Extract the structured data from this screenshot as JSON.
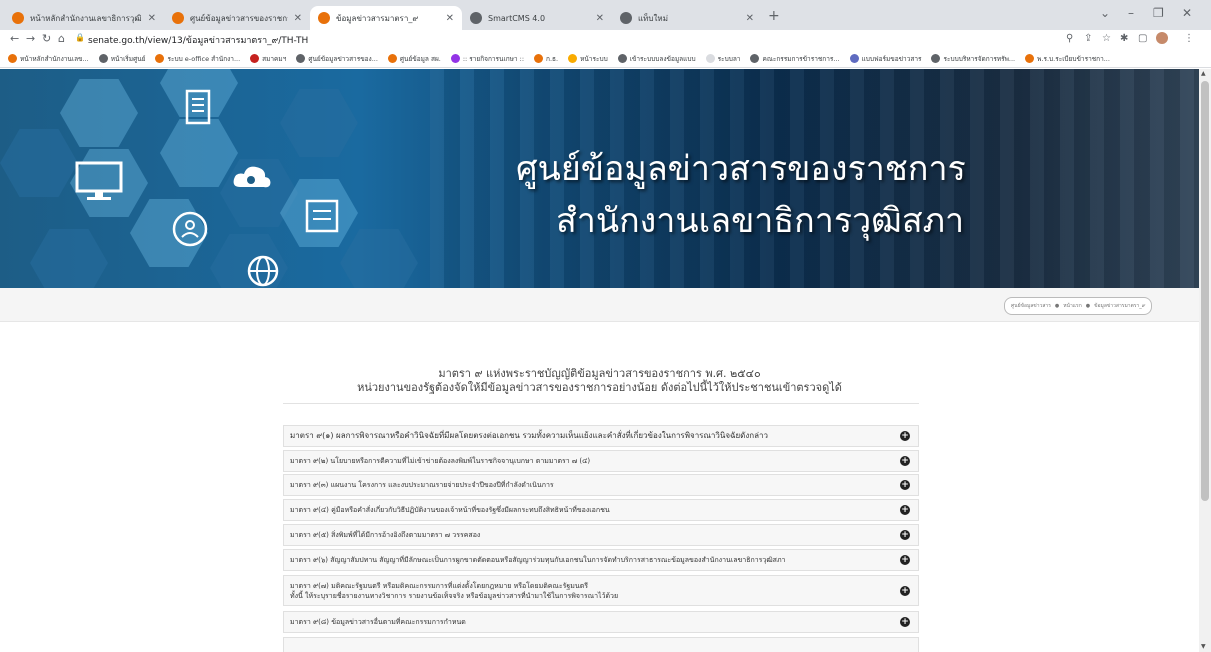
{
  "browser": {
    "tabs": [
      {
        "title": "หน้าหลักสำนักงานเลขาธิการวุฒิสภา",
        "color": "#e8710a"
      },
      {
        "title": "ศูนย์ข้อมูลข่าวสารของราชการ สำนัก",
        "color": "#e8710a"
      },
      {
        "title": "ข้อมูลข่าวสารมาตรา_๙",
        "color": "#e8710a"
      },
      {
        "title": "SmartCMS 4.0",
        "color": "#5f6368"
      },
      {
        "title": "แท็บใหม่",
        "color": "#5f6368"
      }
    ],
    "new_tab": "+",
    "url": "senate.go.th/view/13/ข้อมูลข่าวสารมาตรา_๙/TH-TH",
    "bookmarks": [
      {
        "label": "หน้าหลักสำนักงานเลข...",
        "color": "#e8710a"
      },
      {
        "label": "หน้าเริ่มศูนย์",
        "color": "#5f6368"
      },
      {
        "label": "ระบบ e-office สำนักงา...",
        "color": "#e8710a"
      },
      {
        "label": "สมาคมฯ",
        "color": "#c5221f"
      },
      {
        "label": "ศูนย์ข้อมูลข่าวสารของ...",
        "color": "#5f6368"
      },
      {
        "label": "ศูนย์ข้อมูล สผ.",
        "color": "#e8710a"
      },
      {
        "label": ":: รายกิจการนเกษา ::",
        "color": "#9334e6"
      },
      {
        "label": "ก.ธ.",
        "color": "#e8710a"
      },
      {
        "label": "หน้าระบบ",
        "color": "#f9ab00"
      },
      {
        "label": "เข้าระบบบลงข้อมูลแบบ",
        "color": "#5f6368"
      },
      {
        "label": "ระบบลา",
        "color": "#dadce0"
      },
      {
        "label": "คณะกรรมการข้าราชการ...",
        "color": "#5f6368"
      },
      {
        "label": "แบบฟอร์มขอข่าวสาร",
        "color": "#5f6bc0"
      },
      {
        "label": "ระบบบริหารจัดการทรัพ...",
        "color": "#5f6368"
      },
      {
        "label": "พ.ร.บ.ระเบียบข้าราชกา...",
        "color": "#e8710a"
      }
    ]
  },
  "banner": {
    "title_line1": "ศูนย์ข้อมูลข่าวสารของราชการ",
    "title_line2": "สำนักงานเลขาธิการวุฒิสภา"
  },
  "breadcrumb": [
    "ศูนย์ข้อมูลข่าวสาร",
    "หน้าแรก",
    "ข้อมูลข่าวสารมาตรา_๙"
  ],
  "heading": {
    "line1": "มาตรา ๙ แห่งพระราชบัญญัติข้อมูลข่าวสารของราชการ พ.ศ. ๒๕๔๐",
    "line2": "หน่วยงานของรัฐต้องจัดให้มีข้อมูลข่าวสารของราชการอย่างน้อย ดังต่อไปนี้ไว้ให้ประชาชนเข้าตรวจดูได้"
  },
  "sections": [
    {
      "label": "มาตรา ๙(๑) ผลการพิจารณาหรือคำวินิจฉัยที่มีผลโดยตรงต่อเอกชน รวมทั้งความเห็นแย้งและคำสั่งที่เกี่ยวข้องในการพิจารณาวินิจฉัยดังกล่าว",
      "label2": ""
    },
    {
      "label": "มาตรา ๙(๒) นโยบายหรือการตีความที่ไม่เข้าข่ายต้องลงพิมพ์ในราชกิจจานุเบกษา ตามมาตรา ๗ (๔)",
      "label2": ""
    },
    {
      "label": "มาตรา ๙(๓) แผนงาน โครงการ และงบประมาณรายจ่ายประจำปีของปีที่กำลังดำเนินการ",
      "label2": ""
    },
    {
      "label": "มาตรา ๙(๔) คู่มือหรือคำสั่งเกี่ยวกับวิธีปฏิบัติงานของเจ้าหน้าที่ของรัฐซึ่งมีผลกระทบถึงสิทธิหน้าที่ของเอกชน",
      "label2": ""
    },
    {
      "label": "มาตรา ๙(๕) สิ่งพิมพ์ที่ได้มีการอ้างอิงถึงตามมาตรา ๗ วรรคสอง",
      "label2": ""
    },
    {
      "label": "มาตรา ๙(๖) สัญญาสัมปทาน สัญญาที่มีลักษณะเป็นการผูกขาดตัดตอนหรือสัญญาร่วมทุนกับเอกชนในการจัดทำบริการสาธารณะข้อมูลของสำนักงานเลขาธิการวุฒิสภา",
      "label2": ""
    },
    {
      "label": "มาตรา ๙(๗) มติคณะรัฐมนตรี หรือมติคณะกรรมการที่แต่งตั้งโดยกฎหมาย หรือโดยมติคณะรัฐมนตรี",
      "label2": "ทั้งนี้ ให้ระบุรายชื่อรายงานทางวิชาการ รายงานข้อเท็จจริง หรือข้อมูลข่าวสารที่นำมาใช้ในการพิจารณาไว้ด้วย"
    },
    {
      "label": "มาตรา ๙(๘) ข้อมูลข่าวสารอื่นตามที่คณะกรรมการกำหนด",
      "label2": ""
    }
  ]
}
